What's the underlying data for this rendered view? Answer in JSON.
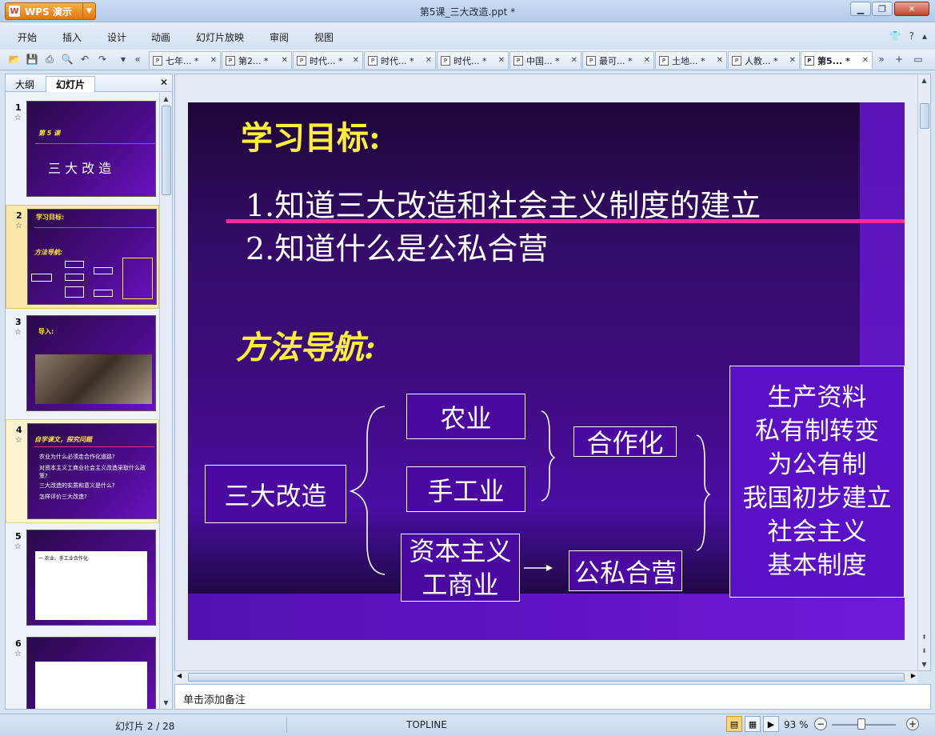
{
  "app": {
    "button_label": "WPS 演示",
    "window_title": "第5课_三大改造.ppt *"
  },
  "menu": [
    "开始",
    "插入",
    "设计",
    "动画",
    "幻灯片放映",
    "审阅",
    "视图"
  ],
  "tabs": [
    "七年... *",
    "第2... *",
    "时代... *",
    "时代... *",
    "时代... *",
    "中国... *",
    "最可... *",
    "土地... *",
    "人教... *",
    "第5... *"
  ],
  "left_pane": {
    "tabs": [
      "大纲",
      "幻灯片"
    ],
    "thumbs": [
      {
        "num": "1",
        "lines": [
          "第 5 课",
          "三 大 改 造"
        ]
      },
      {
        "num": "2",
        "lines": [
          "学习目标:",
          "方法导航:"
        ]
      },
      {
        "num": "3",
        "lines": [
          "导入:"
        ]
      },
      {
        "num": "4",
        "lines": [
          "自学课文，探究问题",
          "农业为什么必须走合作化道路?",
          "对资本主义工商业社会主义改造采取什么政策?",
          "三大改造的实质和意义是什么?",
          "怎样评价三大改造?"
        ]
      },
      {
        "num": "5",
        "lines": [
          "一.农业、手工业合作化"
        ]
      },
      {
        "num": "6",
        "lines": [
          ""
        ]
      }
    ]
  },
  "slide": {
    "title": "学习目标:",
    "goals": [
      "1.知道三大改造和社会主义制度的建立",
      "2.知道什么是公私合营"
    ],
    "method_title": "方法导航:",
    "diagram": {
      "root": "三大改造",
      "agriculture": "农业",
      "handicraft": "手工业",
      "capitalist": [
        "资本主义",
        "工商业"
      ],
      "cooperation": "合作化",
      "joint": "公私合营",
      "result": [
        "生产资料",
        "私有制转变",
        "为公有制",
        "我国初步建立",
        "社会主义",
        "基本制度"
      ]
    }
  },
  "notes_placeholder": "单击添加备注",
  "status": {
    "slide_counter": "幻灯片 2 / 28",
    "theme": "TOPLINE",
    "zoom": "93 %"
  }
}
